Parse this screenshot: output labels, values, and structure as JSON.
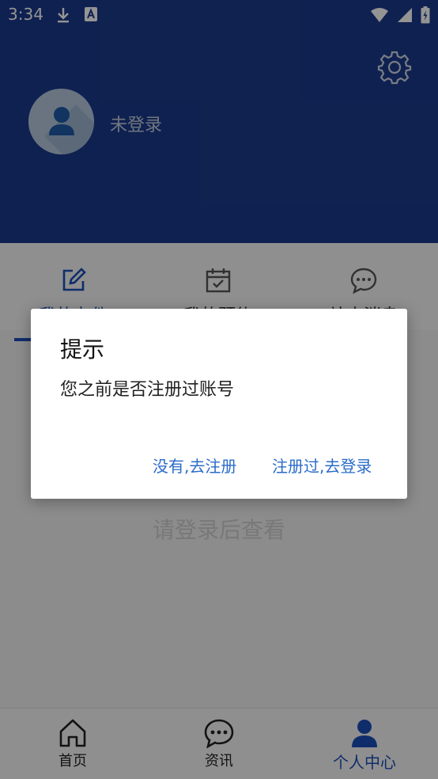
{
  "status_bar": {
    "time": "3:34",
    "icons": [
      "download-icon",
      "a-badge-icon",
      "wifi-icon",
      "cell-signal-icon",
      "battery-charging-icon"
    ]
  },
  "header": {
    "login_status": "未登录",
    "settings_icon": "gear-icon",
    "avatar_icon": "user-avatar-icon"
  },
  "menu": {
    "items": [
      {
        "label": "我的办件",
        "icon": "edit-icon"
      },
      {
        "label": "我的预约",
        "icon": "calendar-check-icon"
      },
      {
        "label": "站内消息",
        "icon": "chat-bubble-icon"
      }
    ]
  },
  "content": {
    "placeholder": "请登录后查看"
  },
  "tabbar": {
    "tabs": [
      {
        "label": "首页",
        "icon": "home-icon"
      },
      {
        "label": "资讯",
        "icon": "chat-icon"
      },
      {
        "label": "个人中心",
        "icon": "person-icon"
      }
    ]
  },
  "dialog": {
    "title": "提示",
    "message": "您之前是否注册过账号",
    "button_no": "没有,去注册",
    "button_yes": "注册过,去登录"
  },
  "colors": {
    "header_bg": "#1a3a8a",
    "accent": "#1a4fb8",
    "dialog_button": "#2a6cc8"
  }
}
